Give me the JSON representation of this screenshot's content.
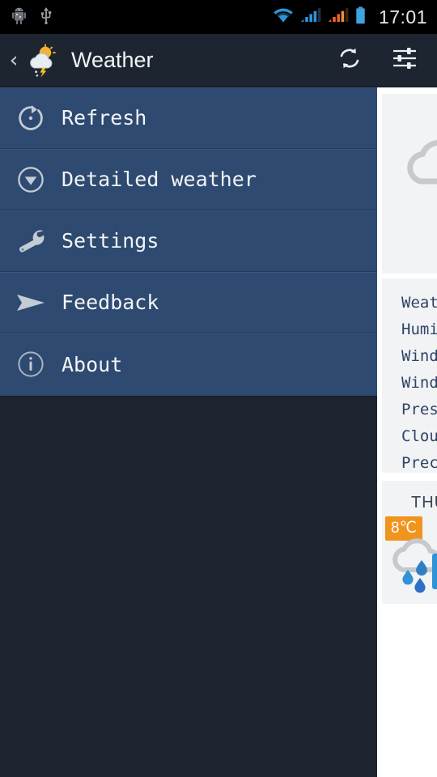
{
  "status_bar": {
    "time": "17:01",
    "icons": [
      {
        "name": "android-debug-icon",
        "label": "android"
      },
      {
        "name": "usb-icon",
        "label": "usb"
      },
      {
        "name": "wifi-icon",
        "label": "wifi"
      },
      {
        "name": "signal-sim1-icon",
        "label": "signal"
      },
      {
        "name": "signal-sim2-icon",
        "label": "signal"
      },
      {
        "name": "battery-icon",
        "label": "battery"
      }
    ],
    "colors": {
      "background": "#000000",
      "wifi": "#2f93d6",
      "signal_sim1": "#2f93d6",
      "signal_sim2": "#e8622a",
      "battery": "#3fa3e0",
      "time_text": "#e8eaec"
    }
  },
  "app_bar": {
    "back_label": "‹",
    "title": "Weather",
    "background": "#1d2531",
    "actions": [
      {
        "name": "refresh-action",
        "label": "Refresh"
      },
      {
        "name": "settings-action",
        "label": "Settings"
      }
    ]
  },
  "drawer": {
    "background": "#2e4a70",
    "items": [
      {
        "label": "Refresh",
        "icon": "refresh-icon"
      },
      {
        "label": "Detailed weather",
        "icon": "chevron-down-circle-icon"
      },
      {
        "label": "Settings",
        "icon": "wrench-icon"
      },
      {
        "label": "Feedback",
        "icon": "send-icon"
      },
      {
        "label": "About",
        "icon": "info-circle-icon"
      }
    ]
  },
  "content": {
    "current_card": {
      "icon": "cloud-rain-icon"
    },
    "details_card": {
      "rows": [
        "Weat",
        "Humi",
        "Wind",
        "Wind",
        "Pres",
        "Clou",
        "Prec"
      ]
    },
    "forecast_card": {
      "day": "THU",
      "temperature": "8℃",
      "badge_color": "#f0941e",
      "icon": "cloud-rain-icon"
    }
  }
}
